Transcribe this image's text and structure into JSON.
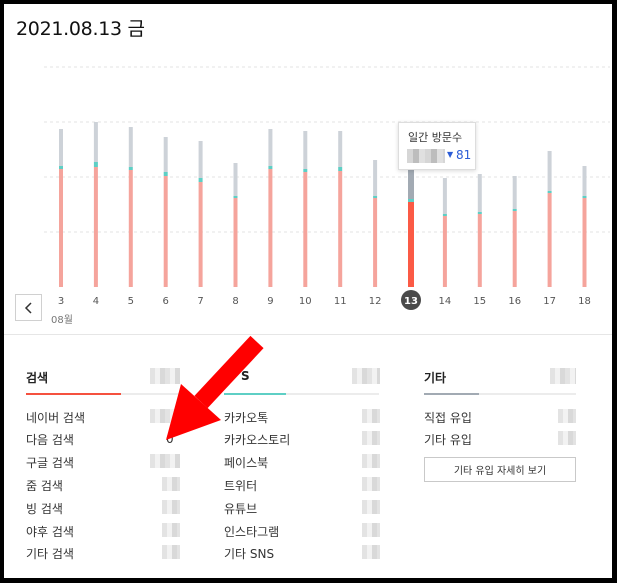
{
  "date_title": "2021.08.13 금",
  "chart_data": {
    "type": "bar",
    "month_label": "08월",
    "categories": [
      "3",
      "4",
      "5",
      "6",
      "7",
      "8",
      "9",
      "10",
      "11",
      "12",
      "13",
      "14",
      "15",
      "16",
      "17",
      "18"
    ],
    "selected_day": "13",
    "series": [
      {
        "values": [
          118,
          120,
          117,
          111,
          105,
          89,
          118,
          115,
          116,
          89,
          85,
          71,
          73,
          76,
          94,
          89
        ],
        "color": "#f5a49c"
      },
      {
        "values": [
          3,
          5,
          3,
          4,
          4,
          2,
          3,
          3,
          4,
          2,
          3,
          2,
          2,
          2,
          2,
          2
        ],
        "color": "#5ecfc5"
      },
      {
        "values": [
          37,
          40,
          40,
          35,
          37,
          33,
          37,
          38,
          36,
          36,
          40,
          36,
          38,
          33,
          40,
          30
        ],
        "color": "#cdd2d8"
      }
    ],
    "selected_colors": [
      "#fb5a45",
      "#5ecfc5",
      "#a2aab3"
    ],
    "ylim": [
      0,
      220
    ]
  },
  "tooltip": {
    "title": "일간 방문수",
    "arrow": "▼",
    "value": "81"
  },
  "sections": {
    "search": {
      "title": "검색",
      "accent": "#f5513f",
      "rows": [
        {
          "label": "네이버 검색"
        },
        {
          "label": "다음 검색",
          "value": "0"
        },
        {
          "label": "구글 검색"
        },
        {
          "label": "줌 검색"
        },
        {
          "label": "빙 검색"
        },
        {
          "label": "야후 검색"
        },
        {
          "label": "기타 검색"
        }
      ]
    },
    "sns": {
      "title": "S",
      "accent": "#5ecfc5",
      "rows": [
        {
          "label": "카카오톡"
        },
        {
          "label": "카카오스토리"
        },
        {
          "label": "페이스북"
        },
        {
          "label": "트위터"
        },
        {
          "label": "유튜브"
        },
        {
          "label": "인스타그램"
        },
        {
          "label": "기타 SNS"
        }
      ]
    },
    "other": {
      "title": "기타",
      "accent": "#a2aab3",
      "rows": [
        {
          "label": "직접 유입"
        },
        {
          "label": "기타 유입"
        }
      ],
      "detail_button": "기타 유입 자세히 보기"
    }
  },
  "annotation_color": "#ff0000",
  "icons": {
    "prev": "chevron-left-icon"
  }
}
